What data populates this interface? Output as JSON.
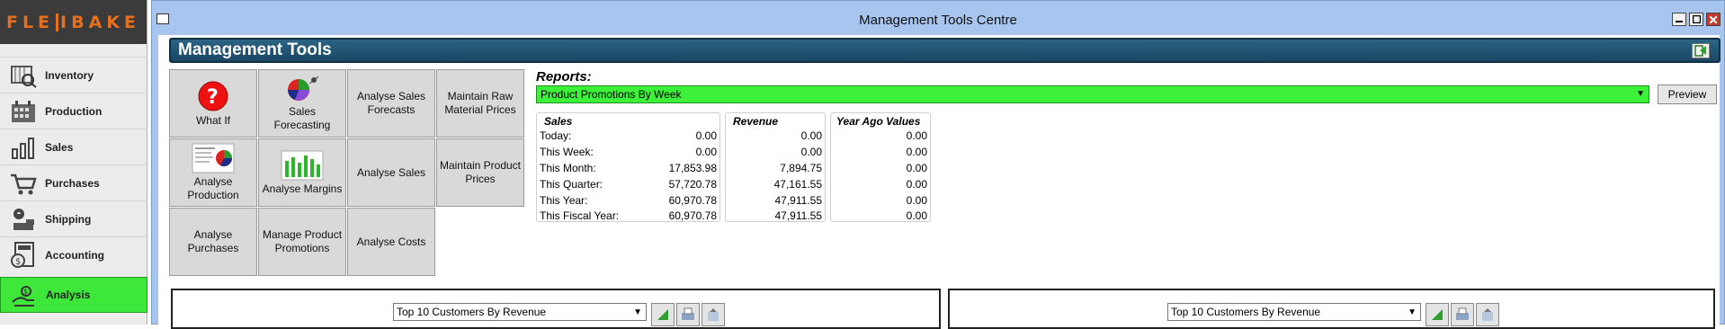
{
  "app": {
    "logo_text": "FLEXIBAKE"
  },
  "sidebar": {
    "items": [
      {
        "label": "Inventory",
        "icon": "inventory-icon"
      },
      {
        "label": "Production",
        "icon": "production-icon"
      },
      {
        "label": "Sales",
        "icon": "sales-icon"
      },
      {
        "label": "Purchases",
        "icon": "purchases-icon"
      },
      {
        "label": "Shipping",
        "icon": "shipping-icon"
      },
      {
        "label": "Accounting",
        "icon": "accounting-icon"
      },
      {
        "label": "Analysis",
        "icon": "analysis-icon",
        "active": true
      }
    ]
  },
  "window": {
    "title": "Management Tools Centre"
  },
  "header": {
    "title": "Management Tools"
  },
  "tools": [
    {
      "label": "What If",
      "icon": "question-icon"
    },
    {
      "label": "Sales Forecasting",
      "icon": "pie-chart-icon"
    },
    {
      "label": "Analyse Sales Forecasts"
    },
    {
      "label": "Maintain Raw Material Prices"
    },
    {
      "label": "Analyse Production",
      "icon": "report-icon"
    },
    {
      "label": "Analyse Margins",
      "icon": "bar-chart-icon"
    },
    {
      "label": "Analyse Sales"
    },
    {
      "label": "Maintain Product Prices"
    },
    {
      "label": "Analyse Purchases"
    },
    {
      "label": "Manage Product Promotions"
    },
    {
      "label": "Analyse Costs"
    }
  ],
  "reports": {
    "label": "Reports:",
    "selected": "Product Promotions By Week",
    "preview_label": "Preview"
  },
  "sales_box": {
    "title": "Sales",
    "rows": [
      {
        "label": "Today:",
        "value": "0.00"
      },
      {
        "label": "This Week:",
        "value": "0.00"
      },
      {
        "label": "This Month:",
        "value": "17,853.98"
      },
      {
        "label": "This Quarter:",
        "value": "57,720.78"
      },
      {
        "label": "This Year:",
        "value": "60,970.78"
      },
      {
        "label": "This Fiscal Year:",
        "value": "60,970.78"
      }
    ]
  },
  "revenue_box": {
    "title": "Revenue",
    "values": [
      "0.00",
      "0.00",
      "7,894.75",
      "47,161.55",
      "47,911.55",
      "47,911.55"
    ]
  },
  "year_ago_box": {
    "title": "Year Ago Values",
    "values": [
      "0.00",
      "0.00",
      "0.00",
      "0.00",
      "0.00",
      "0.00"
    ]
  },
  "panels": [
    {
      "select": "Top 10 Customers By Revenue"
    },
    {
      "select": "Top 10 Customers By Revenue"
    }
  ],
  "colors": {
    "accent_green": "#3de83a",
    "header_blue": "#1f4f6e",
    "window_blue": "#a7c5ee"
  }
}
